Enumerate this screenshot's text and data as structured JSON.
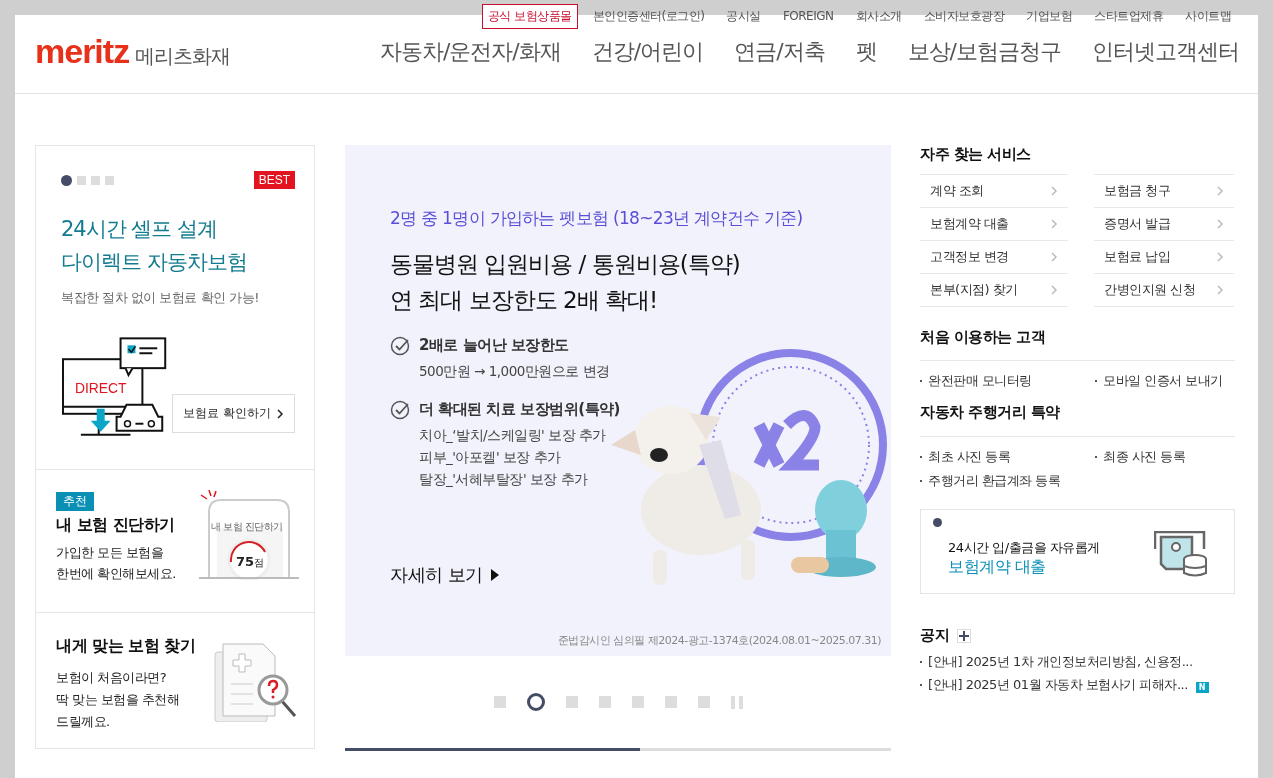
{
  "utility_links": [
    {
      "label": "공식 보험상품몰",
      "kind": "highlight"
    },
    {
      "label": "본인인증센터(로그인)",
      "kind": "link"
    },
    {
      "label": "공시실",
      "kind": "link"
    },
    {
      "label": "FOREIGN",
      "kind": "link"
    },
    {
      "label": "회사소개",
      "kind": "link"
    },
    {
      "label": "소비자보호광장",
      "kind": "link"
    },
    {
      "label": "기업보험",
      "kind": "link"
    },
    {
      "label": "스타트업제휴",
      "kind": "link"
    },
    {
      "label": "사이트맵",
      "kind": "link"
    }
  ],
  "logo": {
    "brand": "meritz",
    "name": "메리츠화재"
  },
  "main_nav": [
    "자동차/운전자/화재",
    "건강/어린이",
    "연금/저축",
    "펫",
    "보상/보험금청구",
    "인터넷고객센터"
  ],
  "promo_card": {
    "pager": [
      {
        "selected": true
      },
      {
        "selected": false
      },
      {
        "selected": false
      },
      {
        "selected": false
      }
    ],
    "badge": "BEST",
    "title_lines": [
      "24시간 셀프 설계",
      "다이렉트 자동차보험"
    ],
    "subtitle": "복잡한 절차 없이 보험료 확인 가능!",
    "illustration_text": "DIRECT",
    "button": "보험료 확인하기"
  },
  "diagnosis_card": {
    "tag": "추천",
    "title": "내 보험 진단하기",
    "description_lines": [
      "가입한 모든 보험을",
      "한번에 확인해보세요."
    ],
    "phone_title": "내 보험 진단하기",
    "score": "75",
    "score_unit": "점"
  },
  "finder_card": {
    "title": "내게 맞는 보험 찾기",
    "description_lines": [
      "보험이 처음이라면?",
      "딱 맞는 보험을 추천해",
      "드릴께요."
    ]
  },
  "banner": {
    "eyebrow": "2명 중 1명이 가입하는 펫보험 (18~23년 계약건수 기준)",
    "headline_lines": [
      "동물병원 입원비용 / 통원비용(특약)",
      "연 최대 보장한도 2배 확대!"
    ],
    "features": [
      {
        "title": "2배로 늘어난 보장한도",
        "details": [
          "500만원 → 1,000만원으로 변경"
        ]
      },
      {
        "title": "더 확대된 치료 보장범위(특약)",
        "details": [
          "치아_‘발치/스케일링' 보장 추가",
          "피부_'아포켈' 보장 추가",
          "탈장_'서혜부탈장' 보장 추가"
        ]
      }
    ],
    "link": "자세히 보기",
    "disclaimer": "준법감시인 심의필 제2024-광고-1374호(2024.08.01~2025.07.31)",
    "pager": [
      {
        "selected": false
      },
      {
        "selected": true
      },
      {
        "selected": false
      },
      {
        "selected": false
      },
      {
        "selected": false
      },
      {
        "selected": false
      },
      {
        "selected": false
      }
    ],
    "progress": {
      "level": 0.54
    }
  },
  "frequent_services": {
    "title": "자주 찾는 서비스",
    "items": [
      "계약 조회",
      "보험금 청구",
      "보험계약 대출",
      "증명서 발급",
      "고객정보 변경",
      "보험료 납입",
      "본부(지점) 찾기",
      "간병인지원 신청"
    ]
  },
  "first_time": {
    "title": "처음 이용하는 고객",
    "links": [
      "완전판매 모니터링",
      "모바일 인증서 보내기"
    ]
  },
  "mileage": {
    "title": "자동차 주행거리 특약",
    "links": [
      "최초 사진 등록",
      "최종 사진 등록",
      "주행거리 환급계좌 등록"
    ]
  },
  "loan_card": {
    "text": "24시간 입/출금을 자유롭게",
    "link": "보험계약 대출"
  },
  "notices": {
    "title": "공지",
    "items": [
      {
        "text": "[안내] 2025년 1차 개인정보처리방침, 신용정..."
      },
      {
        "text": "[안내] 2025년 01월 자동차 보험사기 피해자...",
        "badge": "N"
      }
    ]
  }
}
